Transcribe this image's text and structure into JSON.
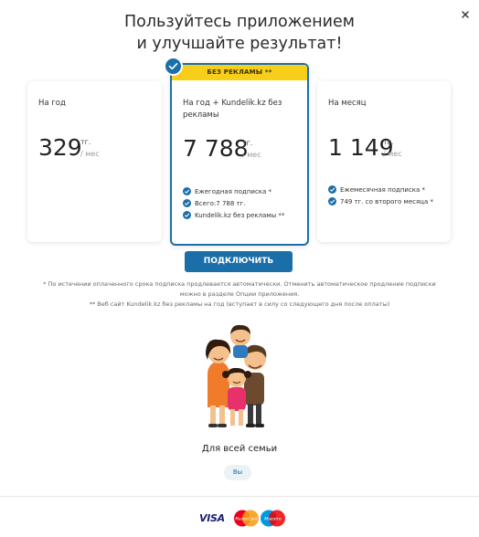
{
  "header": {
    "title_line1": "Пользуйтесь приложением",
    "title_line2": "и улучшайте результат!"
  },
  "plans": [
    {
      "name": "На год",
      "price": "329",
      "currency": "тг.",
      "period": "/ мес",
      "selected": false
    },
    {
      "name": "На год + Kundelik.kz без рекламы",
      "badge": "БЕЗ РЕКЛАМЫ **",
      "price": "7 788",
      "currency": "тг.",
      "period": "/ мес",
      "selected": true,
      "features": [
        "Ежегодная подписка *",
        "Всего:7 788 тг.",
        "Kundelik.kz без рекламы **"
      ]
    },
    {
      "name": "На месяц",
      "price": "1 149",
      "currency": "тг.",
      "period": "/ мес",
      "selected": false,
      "features": [
        "Ежемесячная подписка *",
        "749 тг. со второго месяца *"
      ]
    }
  ],
  "subscribe_button": "ПОДКЛЮЧИТЬ",
  "notes": {
    "line1": "* По истечении оплаченного срока подписка продлевается автоматически. Отменить автоматическое продление подписки",
    "line2": "можно в разделе Опции приложения.",
    "line3": "** Веб сайт Kundelik.kz без рекламы на год (вступает в силу со следующего дня после оплаты)"
  },
  "family": {
    "label": "Для всей семьи",
    "pill": "Вы"
  },
  "payment": {
    "visa": "VISA",
    "mastercard": "MasterCard",
    "maestro": "Maestro"
  },
  "colors": {
    "accent": "#1a6fa8",
    "badge": "#f7cf1a"
  }
}
